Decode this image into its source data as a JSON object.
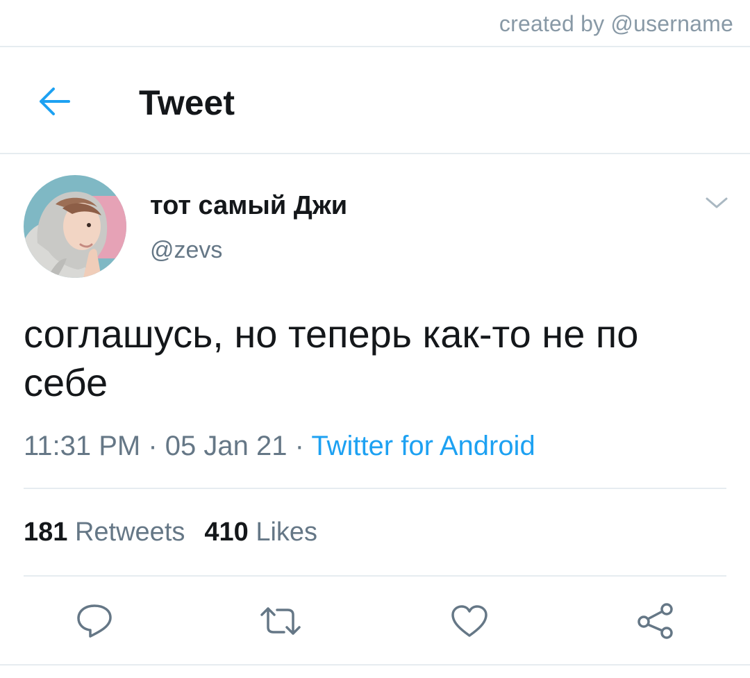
{
  "watermark": {
    "text": "created by @username"
  },
  "header": {
    "back_icon": "arrow-left-icon",
    "title": "Tweet"
  },
  "tweet": {
    "author": {
      "display_name": "тот самый Джи",
      "handle": "@zevs"
    },
    "text": "соглашусь, но теперь как-то не по себе",
    "time": "11:31 PM",
    "separator1": " · ",
    "date": "05 Jan 21",
    "separator2": " · ",
    "source": "Twitter for Android",
    "stats": {
      "retweets_count": "181",
      "retweets_label": "Retweets",
      "likes_count": "410",
      "likes_label": "Likes"
    },
    "actions": [
      "reply-icon",
      "retweet-icon",
      "like-icon",
      "share-icon"
    ]
  },
  "colors": {
    "accent": "#1da1f2",
    "secondary_text": "#657786",
    "primary_text": "#14171a",
    "divider": "#e6ecf0"
  }
}
